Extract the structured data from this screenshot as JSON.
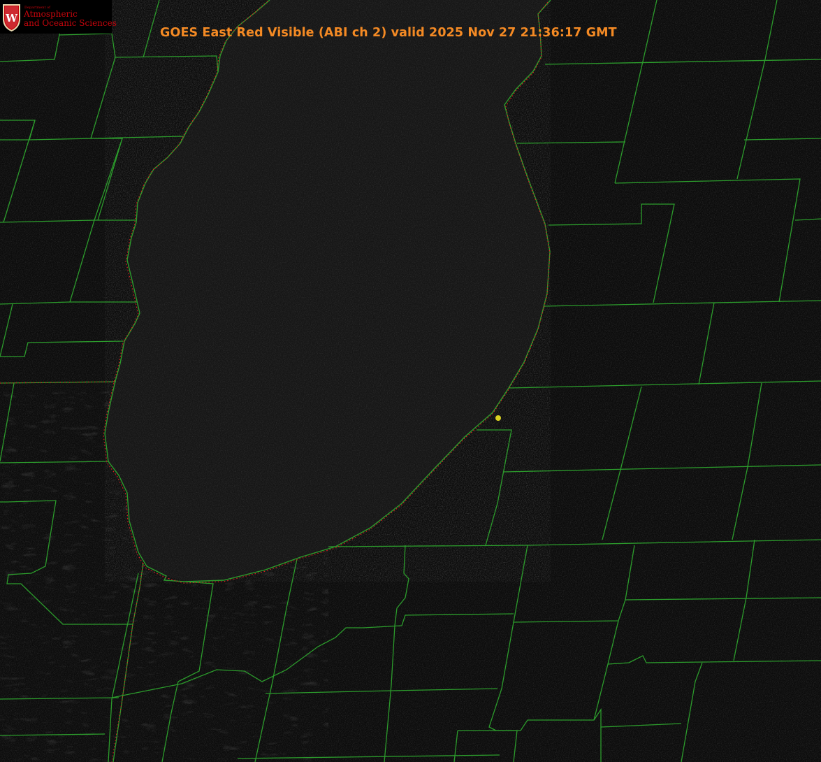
{
  "title": "GOES East Red Visible (ABI ch 2) valid 2025 Nov 27 21:36:17 GMT",
  "logo": {
    "department": "Department of",
    "line1": "Atmospheric",
    "line2": "and Oceanic Sciences",
    "crest_letter": "W"
  },
  "colors": {
    "title": "#f48a24",
    "county_lines": "#2c9c2c",
    "coastline": "#e02020",
    "station_marker": "#d8d020",
    "logo_text": "#c5050c",
    "background": "#0b0b0b"
  },
  "map_features": {
    "lake": "lake-surface",
    "station_marker": "station-marker"
  }
}
